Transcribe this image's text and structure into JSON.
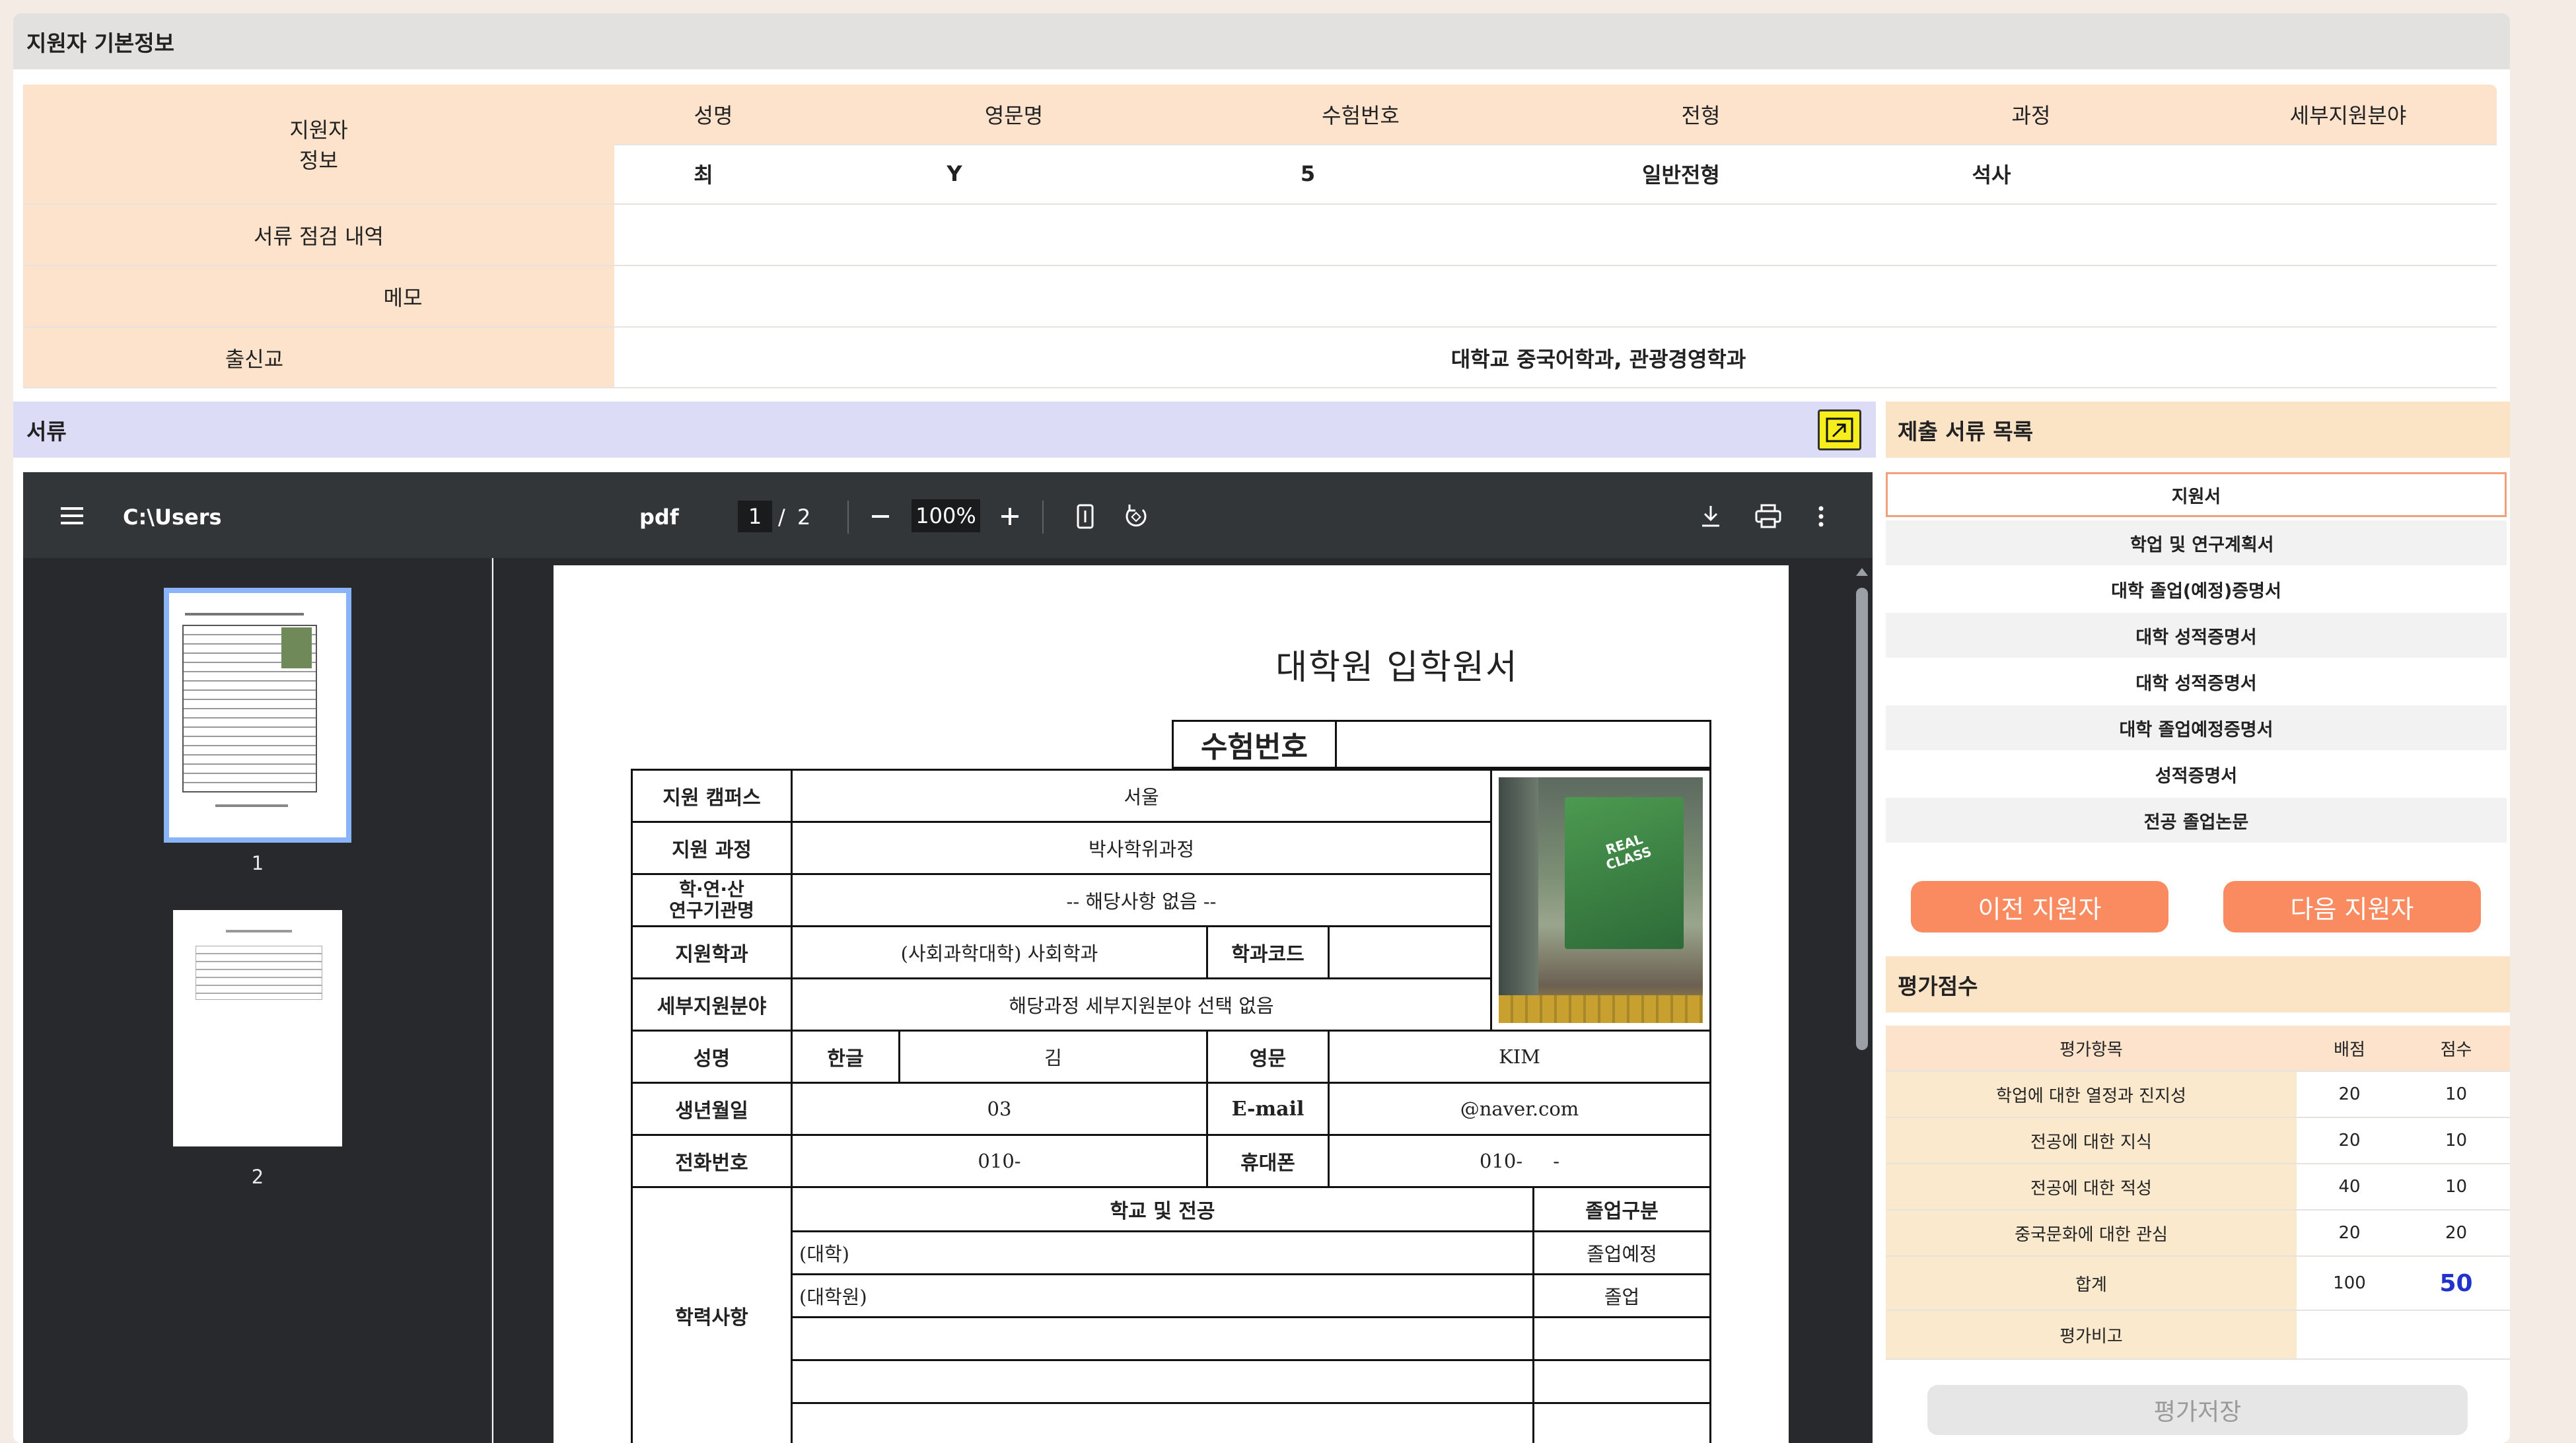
{
  "applicant_section": {
    "title": "지원자 기본정보",
    "row_label": "지원자\n정보",
    "columns": [
      "성명",
      "영문명",
      "수험번호",
      "전형",
      "과정",
      "세부지원분야"
    ],
    "values": [
      "최",
      "Y",
      "5",
      "일반전형",
      "석사",
      ""
    ],
    "review_label": "서류 점검 내역",
    "review_value": "",
    "memo_label": "메모",
    "memo_value": "",
    "school_label": "출신교",
    "school_value": "대학교 중국어학과, 관광경영학과"
  },
  "docs_section": {
    "title": "서류",
    "list_title": "제출 서류 목록"
  },
  "pdf_viewer": {
    "path": "C:\\Users",
    "filename": "pdf",
    "current_page": "1",
    "separator": "/",
    "total_pages": "2",
    "zoom": "100%",
    "thumb_labels": [
      "1",
      "2"
    ]
  },
  "form": {
    "title": "대학원 입학원서",
    "exam_no_label": "수험번호",
    "campus_label": "지원 캠퍼스",
    "campus": "서울",
    "course_label": "지원 과정",
    "course": "박사학위과정",
    "industry_label": "학·연·산\n연구기관명",
    "industry": "-- 해당사항 없음 --",
    "dept_label": "지원학과",
    "dept": "(사회과학대학) 사회학과",
    "dept_code_label": "학과코드",
    "dept_code": "",
    "field_label": "세부지원분야",
    "field": "해당과정 세부지원분야 선택 없음",
    "name_label": "성명",
    "korean_label": "한글",
    "korean_name": "김",
    "english_label": "영문",
    "english_name": "KIM",
    "birth_label": "생년월일",
    "birth": "03",
    "email_label": "E-mail",
    "email": "@naver.com",
    "phone_label": "전화번호",
    "phone": "010-",
    "mobile_label": "휴대폰",
    "mobile": "010-     -",
    "edu_label": "학력사항",
    "school_major_label": "학교 및 전공",
    "grad_type_label": "졸업구분",
    "edu_rows": [
      {
        "school": "(대학)",
        "type": "졸업예정"
      },
      {
        "school": "(대학원)",
        "type": "졸업"
      }
    ],
    "photo_text": "REAL\nCLASS"
  },
  "doc_list": [
    "지원서",
    "학업 및 연구계획서",
    "대학 졸업(예정)증명서",
    "대학 성적증명서",
    "대학 성적증명서",
    "대학 졸업예정증명서",
    "성적증명서",
    "전공 졸업논문"
  ],
  "nav": {
    "prev": "이전 지원자",
    "next": "다음 지원자"
  },
  "eval": {
    "title": "평가점수",
    "headers": [
      "평가항목",
      "배점",
      "점수"
    ],
    "rows": [
      {
        "item": "학업에 대한 열정과 진지성",
        "max": "20",
        "score": "10"
      },
      {
        "item": "전공에 대한 지식",
        "max": "20",
        "score": "10"
      },
      {
        "item": "전공에 대한 적성",
        "max": "40",
        "score": "10"
      },
      {
        "item": "중국문화에 대한 관심",
        "max": "20",
        "score": "20"
      }
    ],
    "total_label": "합계",
    "total_max": "100",
    "total_score": "50",
    "remark_label": "평가비고",
    "remark": "",
    "save": "평가저장"
  },
  "colors": {
    "peach": "#fde2cc",
    "lavender": "#dcdcf6",
    "orange_button": "#fa8a5f",
    "total_score_blue": "#2233cc",
    "highlight_yellow": "#f5ee1c"
  }
}
